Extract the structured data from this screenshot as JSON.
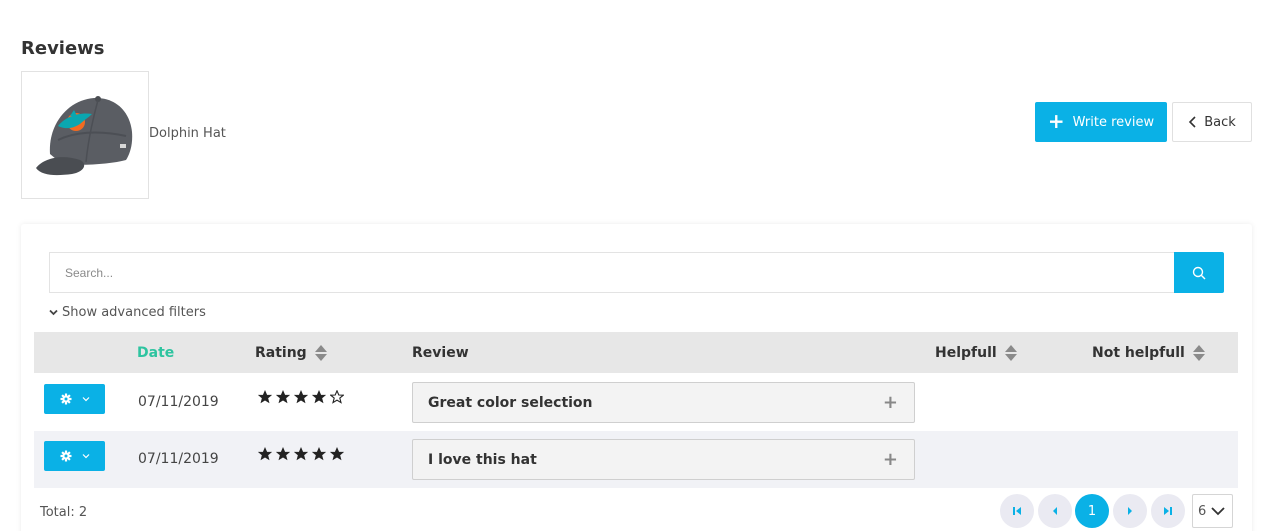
{
  "page": {
    "title": "Reviews"
  },
  "product": {
    "name": "Dolphin Hat",
    "image_icon": "cap-product-image",
    "cap_logo_colors": [
      "#0aa7b0",
      "#f26b21"
    ]
  },
  "actions": {
    "write_review_label": "Write review",
    "back_label": "Back"
  },
  "search": {
    "placeholder": "Search..."
  },
  "filters": {
    "advanced_label": "Show advanced filters"
  },
  "table": {
    "columns": {
      "date": "Date",
      "rating": "Rating",
      "review": "Review",
      "helpful": "Helpfull",
      "not_helpful": "Not helpfull"
    },
    "rows": [
      {
        "date": "07/11/2019",
        "rating": 4,
        "max_rating": 5,
        "review": "Great color selection"
      },
      {
        "date": "07/11/2019",
        "rating": 5,
        "max_rating": 5,
        "review": "I love this hat"
      }
    ]
  },
  "footer": {
    "total": "Total: 2",
    "current_page": "1",
    "page_size": "6"
  },
  "colors": {
    "accent": "#0ab1e6",
    "sorted_column": "#2ec4a0",
    "header_bg": "#e7e7e7",
    "alt_row_bg": "#f1f2f6"
  }
}
